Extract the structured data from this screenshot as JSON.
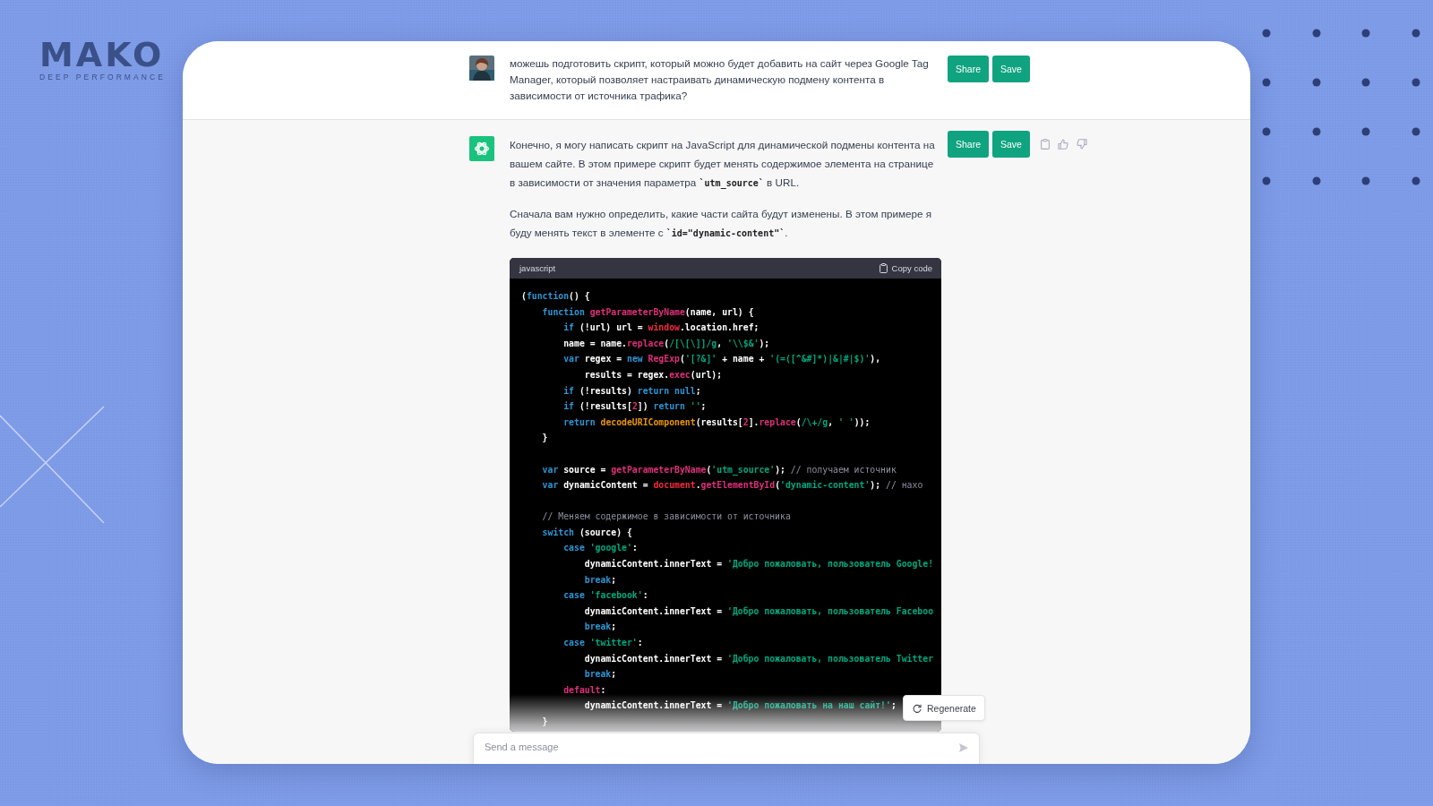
{
  "logo": {
    "name": "MAKO",
    "tagline": "DEEP PERFORMANCE"
  },
  "messages": [
    {
      "kind": "user",
      "paragraphs": [
        "можешь подготовить скрипт, который можно будет добавить на сайт через Google Tag Manager, который позволяет настраивать динамическую подмену контента в зависимости от источника трафика?"
      ],
      "buttons": [
        "Share",
        "Save"
      ]
    },
    {
      "kind": "assistant",
      "paragraphs": [
        "Конечно, я могу написать скрипт на JavaScript для динамической подмены контента на вашем сайте. В этом примере скрипт будет менять содержимое элемента на странице в зависимости от значения параметра **`utm_source`** в URL.",
        "Сначала вам нужно определить, какие части сайта будут изменены. В этом примере я буду менять текст в элементе с **`id=\"dynamic-content\"`**."
      ],
      "buttons": [
        "Share",
        "Save"
      ],
      "code_block": {
        "language": "javascript",
        "copy_label": "Copy code",
        "lines": [
          {
            "kind": "code",
            "tokens": [
              {
                "kind": "plain",
                "text": "("
              },
              {
                "kind": "keyword",
                "text": "function"
              },
              {
                "kind": "plain",
                "text": "() {"
              }
            ]
          },
          {
            "kind": "code",
            "tokens": [
              {
                "kind": "keyword",
                "text": "    function "
              },
              {
                "kind": "function",
                "text": "getParameterByName"
              },
              {
                "kind": "plain",
                "text": "(name, url) {"
              }
            ]
          },
          {
            "kind": "code",
            "tokens": [
              {
                "kind": "keyword",
                "text": "        if"
              },
              {
                "kind": "plain",
                "text": " (!url) url = "
              },
              {
                "kind": "builtin",
                "text": "window"
              },
              {
                "kind": "plain",
                "text": ".location.href;"
              }
            ]
          },
          {
            "kind": "code",
            "tokens": [
              {
                "kind": "plain",
                "text": "        name = name."
              },
              {
                "kind": "function",
                "text": "replace"
              },
              {
                "kind": "plain",
                "text": "("
              },
              {
                "kind": "string",
                "text": "/[\\[\\]]/g"
              },
              {
                "kind": "plain",
                "text": ", "
              },
              {
                "kind": "string",
                "text": "'\\\\$&'"
              },
              {
                "kind": "plain",
                "text": ");"
              }
            ]
          },
          {
            "kind": "code",
            "tokens": [
              {
                "kind": "keyword",
                "text": "        var"
              },
              {
                "kind": "plain",
                "text": " regex = "
              },
              {
                "kind": "keyword",
                "text": "new "
              },
              {
                "kind": "function",
                "text": "RegExp"
              },
              {
                "kind": "plain",
                "text": "("
              },
              {
                "kind": "string",
                "text": "'[?&]'"
              },
              {
                "kind": "plain",
                "text": " + name + "
              },
              {
                "kind": "string",
                "text": "'(=([^&#]*)|&|#|$)'"
              },
              {
                "kind": "plain",
                "text": "),"
              }
            ]
          },
          {
            "kind": "code",
            "tokens": [
              {
                "kind": "plain",
                "text": "            results = regex."
              },
              {
                "kind": "function",
                "text": "exec"
              },
              {
                "kind": "plain",
                "text": "(url);"
              }
            ]
          },
          {
            "kind": "code",
            "tokens": [
              {
                "kind": "keyword",
                "text": "        if"
              },
              {
                "kind": "plain",
                "text": " (!results) "
              },
              {
                "kind": "keyword",
                "text": "return null"
              },
              {
                "kind": "plain",
                "text": ";"
              }
            ]
          },
          {
            "kind": "code",
            "tokens": [
              {
                "kind": "keyword",
                "text": "        if"
              },
              {
                "kind": "plain",
                "text": " (!results["
              },
              {
                "kind": "number",
                "text": "2"
              },
              {
                "kind": "plain",
                "text": "]) "
              },
              {
                "kind": "keyword",
                "text": "return "
              },
              {
                "kind": "string",
                "text": "''"
              },
              {
                "kind": "plain",
                "text": ";"
              }
            ]
          },
          {
            "kind": "code",
            "tokens": [
              {
                "kind": "keyword",
                "text": "        return "
              },
              {
                "kind": "special",
                "text": "decodeURIComponent"
              },
              {
                "kind": "plain",
                "text": "(results["
              },
              {
                "kind": "number",
                "text": "2"
              },
              {
                "kind": "plain",
                "text": "]."
              },
              {
                "kind": "function",
                "text": "replace"
              },
              {
                "kind": "plain",
                "text": "("
              },
              {
                "kind": "string",
                "text": "/\\+/g"
              },
              {
                "kind": "plain",
                "text": ", "
              },
              {
                "kind": "string",
                "text": "' '"
              },
              {
                "kind": "plain",
                "text": "));"
              }
            ]
          },
          {
            "kind": "code",
            "tokens": [
              {
                "kind": "plain",
                "text": "    }"
              }
            ]
          },
          {
            "kind": "blank"
          },
          {
            "kind": "code",
            "tokens": [
              {
                "kind": "keyword",
                "text": "    var"
              },
              {
                "kind": "plain",
                "text": " source = "
              },
              {
                "kind": "function",
                "text": "getParameterByName"
              },
              {
                "kind": "plain",
                "text": "("
              },
              {
                "kind": "string",
                "text": "'utm_source'"
              },
              {
                "kind": "plain",
                "text": "); "
              },
              {
                "kind": "comment",
                "text": "// получаем источник"
              }
            ]
          },
          {
            "kind": "code",
            "tokens": [
              {
                "kind": "keyword",
                "text": "    var"
              },
              {
                "kind": "plain",
                "text": " dynamicContent = "
              },
              {
                "kind": "builtin",
                "text": "document"
              },
              {
                "kind": "plain",
                "text": "."
              },
              {
                "kind": "function",
                "text": "getElementById"
              },
              {
                "kind": "plain",
                "text": "("
              },
              {
                "kind": "string",
                "text": "'dynamic-content'"
              },
              {
                "kind": "plain",
                "text": "); "
              },
              {
                "kind": "comment",
                "text": "// нахо"
              }
            ]
          },
          {
            "kind": "blank"
          },
          {
            "kind": "code",
            "tokens": [
              {
                "kind": "comment",
                "text": "    // Меняем содержимое в зависимости от источника"
              }
            ]
          },
          {
            "kind": "code",
            "tokens": [
              {
                "kind": "keyword",
                "text": "    switch"
              },
              {
                "kind": "plain",
                "text": " (source) {"
              }
            ]
          },
          {
            "kind": "code",
            "tokens": [
              {
                "kind": "keyword",
                "text": "        case "
              },
              {
                "kind": "string",
                "text": "'google'"
              },
              {
                "kind": "plain",
                "text": ":"
              }
            ]
          },
          {
            "kind": "code",
            "tokens": [
              {
                "kind": "plain",
                "text": "            dynamicContent.innerText = "
              },
              {
                "kind": "string",
                "text": "'Добро пожаловать, пользователь Google!"
              }
            ]
          },
          {
            "kind": "code",
            "tokens": [
              {
                "kind": "keyword",
                "text": "            break"
              },
              {
                "kind": "plain",
                "text": ";"
              }
            ]
          },
          {
            "kind": "code",
            "tokens": [
              {
                "kind": "keyword",
                "text": "        case "
              },
              {
                "kind": "string",
                "text": "'facebook'"
              },
              {
                "kind": "plain",
                "text": ":"
              }
            ]
          },
          {
            "kind": "code",
            "tokens": [
              {
                "kind": "plain",
                "text": "            dynamicContent.innerText = "
              },
              {
                "kind": "string",
                "text": "'Добро пожаловать, пользователь Faceboo"
              }
            ]
          },
          {
            "kind": "code",
            "tokens": [
              {
                "kind": "keyword",
                "text": "            break"
              },
              {
                "kind": "plain",
                "text": ";"
              }
            ]
          },
          {
            "kind": "code",
            "tokens": [
              {
                "kind": "keyword",
                "text": "        case "
              },
              {
                "kind": "string",
                "text": "'twitter'"
              },
              {
                "kind": "plain",
                "text": ":"
              }
            ]
          },
          {
            "kind": "code",
            "tokens": [
              {
                "kind": "plain",
                "text": "            dynamicContent.innerText = "
              },
              {
                "kind": "string",
                "text": "'Добро пожаловать, пользователь Twitter"
              }
            ]
          },
          {
            "kind": "code",
            "tokens": [
              {
                "kind": "keyword",
                "text": "            break"
              },
              {
                "kind": "plain",
                "text": ";"
              }
            ]
          },
          {
            "kind": "code",
            "tokens": [
              {
                "kind": "number",
                "text": "        default"
              },
              {
                "kind": "plain",
                "text": ":"
              }
            ]
          },
          {
            "kind": "code",
            "tokens": [
              {
                "kind": "plain",
                "text": "            dynamicContent.innerText = "
              },
              {
                "kind": "string",
                "text": "'Добро пожаловать на наш сайт!'"
              },
              {
                "kind": "plain",
                "text": ";"
              }
            ]
          },
          {
            "kind": "code",
            "tokens": [
              {
                "kind": "plain",
                "text": "    }"
              }
            ]
          }
        ]
      }
    }
  ],
  "regenerate_button": "Regenerate",
  "composer": {
    "placeholder": "Send a message"
  }
}
